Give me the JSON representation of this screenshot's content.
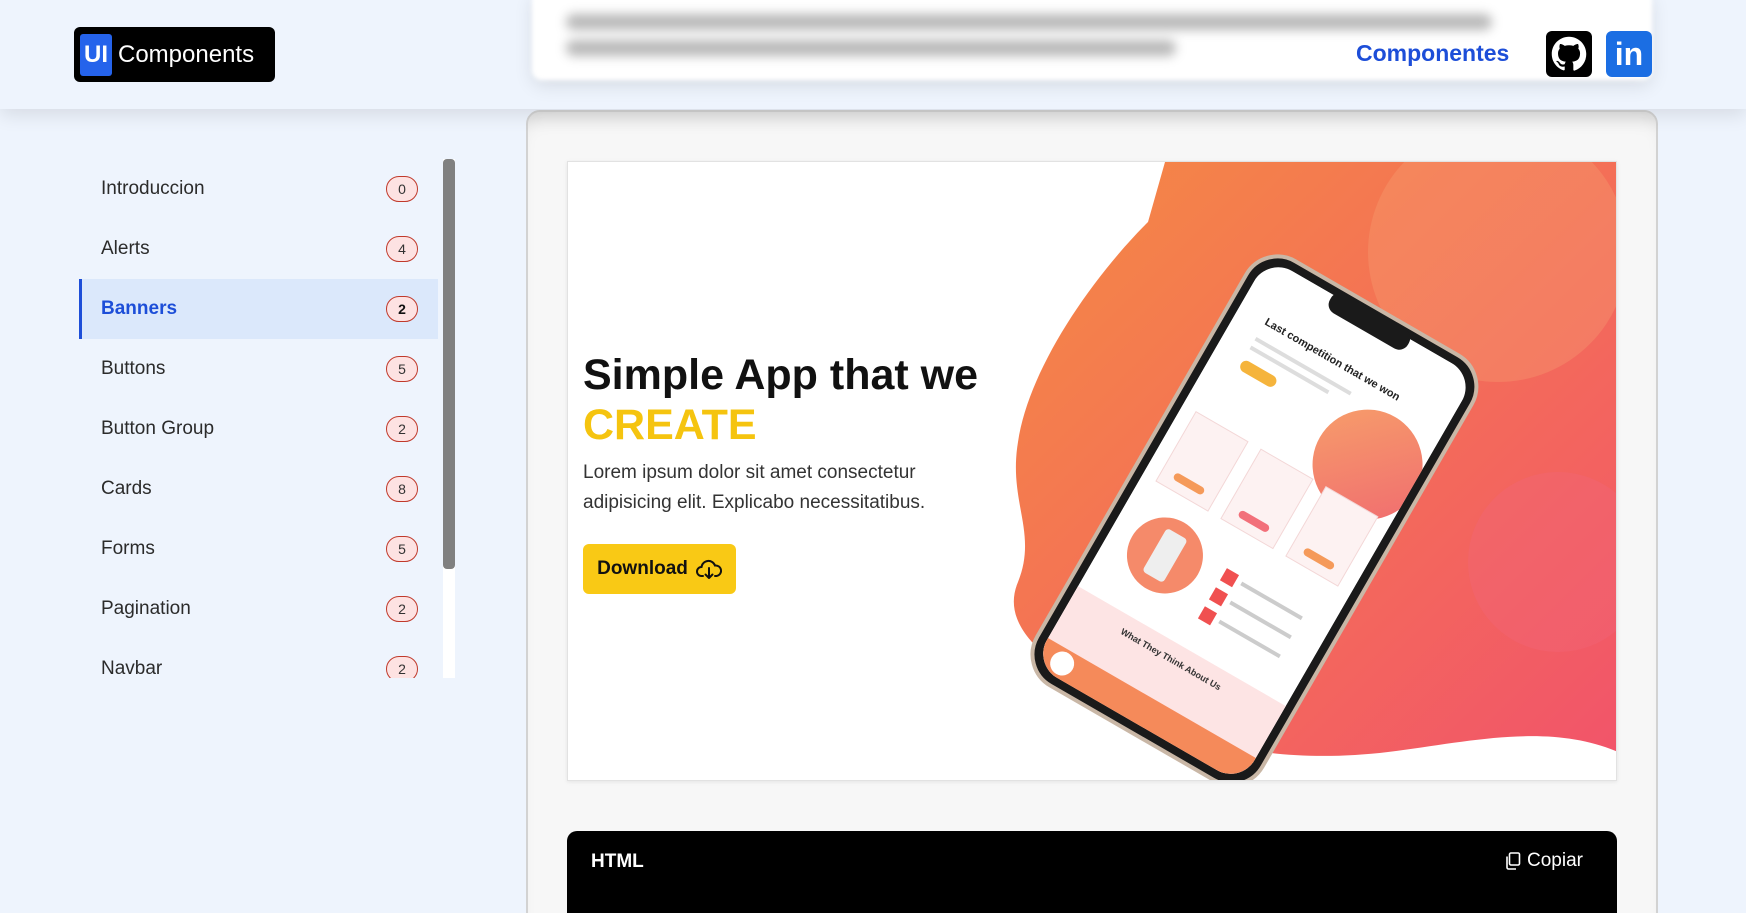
{
  "header": {
    "logo_badge": "UI",
    "logo_text": "Components",
    "nav_link": "Componentes",
    "icons": [
      "github-icon",
      "linkedin-icon"
    ],
    "linkedin_glyph": "in",
    "accent": "#1d4ed8"
  },
  "sidebar": {
    "items": [
      {
        "label": "Introduccion",
        "count": "0",
        "active": false
      },
      {
        "label": "Alerts",
        "count": "4",
        "active": false
      },
      {
        "label": "Banners",
        "count": "2",
        "active": true
      },
      {
        "label": "Buttons",
        "count": "5",
        "active": false
      },
      {
        "label": "Button Group",
        "count": "2",
        "active": false
      },
      {
        "label": "Cards",
        "count": "8",
        "active": false
      },
      {
        "label": "Forms",
        "count": "5",
        "active": false
      },
      {
        "label": "Pagination",
        "count": "2",
        "active": false
      },
      {
        "label": "Navbar",
        "count": "2",
        "active": false
      }
    ]
  },
  "banner": {
    "title": "Simple App that we",
    "highlight": "CREATE",
    "description": "Lorem ipsum dolor sit amet consectetur adipisicing elit. Explicabo necessitatibus.",
    "button_label": "Download",
    "phone_screen": {
      "heading": "Last competition that we won",
      "section": "What They Think About Us"
    },
    "highlight_color": "#f5c40f",
    "button_color": "#f9c915"
  },
  "code": {
    "language": "HTML",
    "copy_label": "Copiar"
  }
}
